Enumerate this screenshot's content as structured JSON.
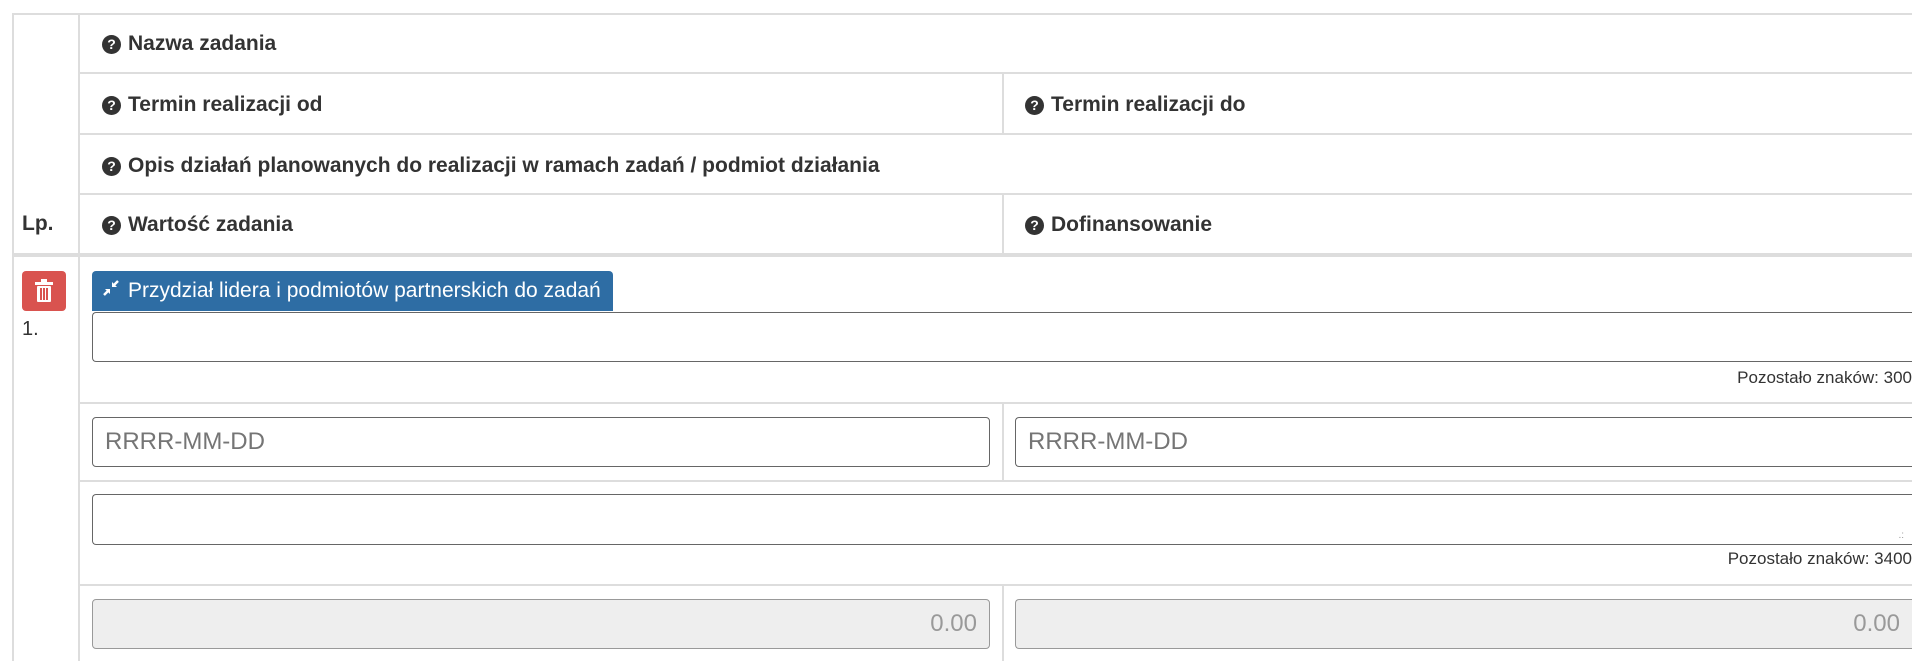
{
  "headers": {
    "task_name": "Nazwa zadania",
    "date_from": "Termin realizacji od",
    "date_to": "Termin realizacji do",
    "description": "Opis działań planowanych do realizacji w ramach zadań / podmiot działania",
    "task_value": "Wartość zadania",
    "funding": "Dofinansowanie",
    "lp": "Lp.",
    "help_icon": "?"
  },
  "row": {
    "number": "1.",
    "assign_button_label": "Przydział lidera i podmiotów partnerskich do zadań",
    "task_name_value": "",
    "task_name_remaining": "Pozostało znaków: 300",
    "date_from_placeholder": "RRRR-MM-DD",
    "date_to_placeholder": "RRRR-MM-DD",
    "description_value": "",
    "description_remaining": "Pozostało znaków: 3400",
    "task_value": "0.00",
    "funding_value": "0.00"
  },
  "icons": {
    "help": "question-circle-icon",
    "delete": "trash-icon",
    "assign": "compress-arrows-icon"
  },
  "colors": {
    "delete_button": "#d9534f",
    "assign_button": "#2e6da4",
    "border": "#dddddd",
    "readonly_bg": "#eeeeee"
  }
}
